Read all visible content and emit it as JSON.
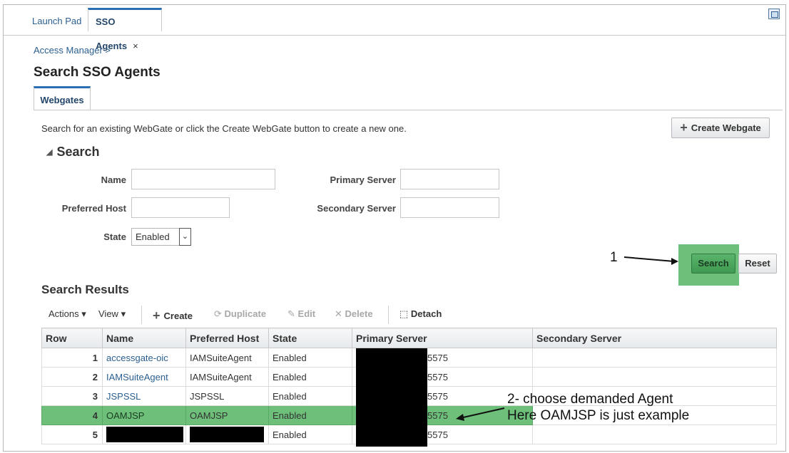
{
  "tabs": [
    {
      "label": "Launch Pad"
    },
    {
      "label": "SSO Agents",
      "close": "×"
    }
  ],
  "breadcrumb": "Access Manager >",
  "page_title": "Search SSO Agents",
  "subtab": "Webgates",
  "help_text": "Search for an existing WebGate or click the Create WebGate button to create a new one.",
  "create_webgate": "Create Webgate",
  "search": {
    "header": "Search",
    "name_label": "Name",
    "preferred_host_label": "Preferred Host",
    "state_label": "State",
    "state_value": "Enabled",
    "primary_server_label": "Primary Server",
    "secondary_server_label": "Secondary Server",
    "search_button": "Search",
    "reset_button": "Reset"
  },
  "results": {
    "header": "Search Results",
    "toolbar": {
      "actions": "Actions",
      "view": "View",
      "create": "Create",
      "duplicate": "Duplicate",
      "edit": "Edit",
      "delete": "Delete",
      "detach": "Detach"
    },
    "columns": [
      "Row",
      "Name",
      "Preferred Host",
      "State",
      "Primary Server",
      "Secondary Server"
    ],
    "rows": [
      {
        "row": "1",
        "name": "accessgate-oic",
        "host": "IAMSuiteAgent",
        "state": "Enabled",
        "primary": "5575",
        "secondary": ""
      },
      {
        "row": "2",
        "name": "IAMSuiteAgent",
        "host": "IAMSuiteAgent",
        "state": "Enabled",
        "primary": "5575",
        "secondary": ""
      },
      {
        "row": "3",
        "name": "JSPSSL",
        "host": "JSPSSL",
        "state": "Enabled",
        "primary": "5575",
        "secondary": ""
      },
      {
        "row": "4",
        "name": "OAMJSP",
        "host": "OAMJSP",
        "state": "Enabled",
        "primary": "5575",
        "secondary": ""
      },
      {
        "row": "5",
        "name": "",
        "host": "",
        "state": "Enabled",
        "primary": "5575",
        "secondary": ""
      }
    ]
  },
  "annotations": {
    "step1": "1",
    "step2_line1": "2- choose demanded Agent",
    "step2_line2": "Here OAMJSP is just example"
  },
  "colors": {
    "highlight": "#6dbf7a",
    "link": "#2b5f8f",
    "tab_accent": "#2a6fb1"
  }
}
